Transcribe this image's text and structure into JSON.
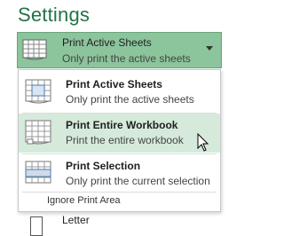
{
  "settings": {
    "title": "Settings"
  },
  "selector": {
    "label": "Print Active Sheets",
    "description": "Only print the active sheets",
    "icon": "sheet-grid-icon"
  },
  "dropdown": {
    "options": [
      {
        "label": "Print Active Sheets",
        "description": "Only print the active sheets",
        "icon": "active-sheets-icon"
      },
      {
        "label": "Print Entire Workbook",
        "description": "Print the entire workbook",
        "icon": "entire-workbook-icon",
        "state": "hover"
      },
      {
        "label": "Print Selection",
        "description": "Only print the current selection",
        "icon": "print-selection-icon"
      }
    ],
    "ignore_label": "Ignore Print Area"
  },
  "paper": {
    "label": "Letter"
  },
  "colors": {
    "accent": "#217346",
    "selected": "#8cc49c",
    "hover": "#d5eadb"
  }
}
